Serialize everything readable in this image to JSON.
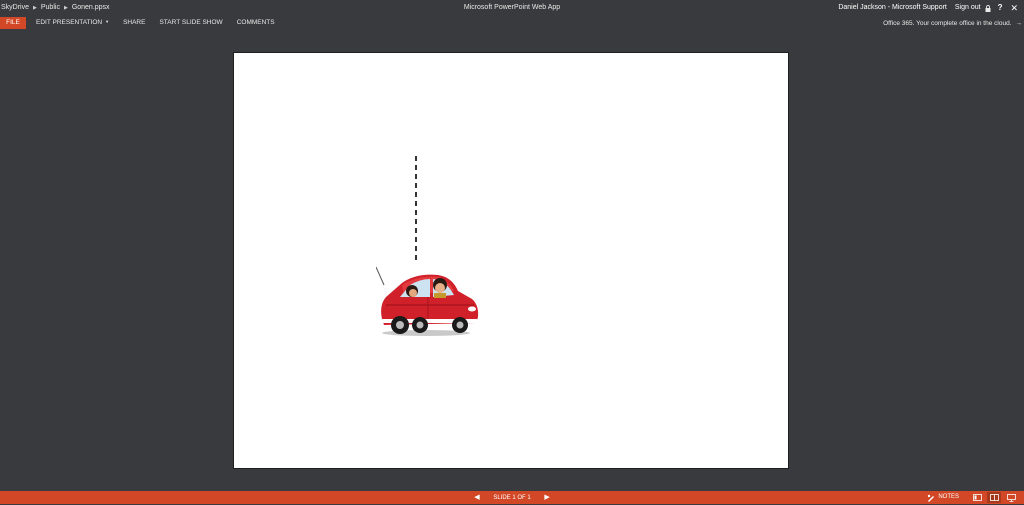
{
  "topbar": {
    "breadcrumb": [
      "SkyDrive",
      "Public",
      "Gonen.ppsx"
    ],
    "app_title": "Microsoft PowerPoint Web App",
    "user": "Daniel Jackson - Microsoft Support",
    "sign_out": "Sign out",
    "help": "?",
    "close": "✕"
  },
  "ribbon": {
    "file": "FILE",
    "menu": [
      "EDIT PRESENTATION",
      "SHARE",
      "START SLIDE SHOW",
      "COMMENTS"
    ],
    "promo": "Office 365.  Your complete office in the cloud.",
    "promo_arrow": "→"
  },
  "status": {
    "slide_counter": "SLIDE 1 OF 1",
    "notes": "NOTES"
  },
  "colors": {
    "accent": "#d24726",
    "background": "#393a3d",
    "slide": "#ffffff"
  }
}
